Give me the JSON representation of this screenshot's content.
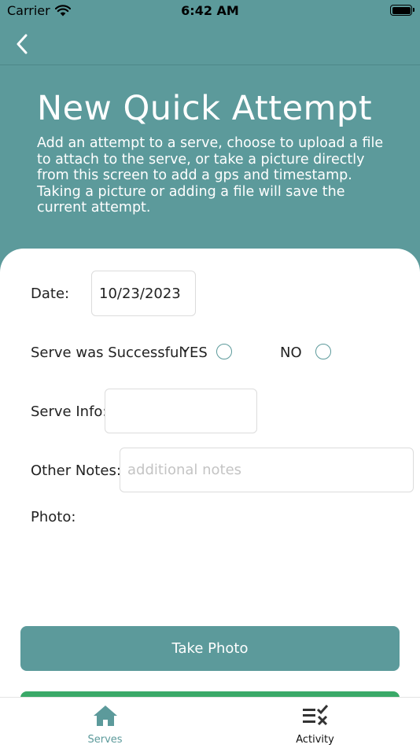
{
  "status_bar": {
    "carrier": "Carrier",
    "time": "6:42 AM"
  },
  "header": {
    "title": "New Quick Attempt",
    "description": "Add an attempt to a serve, choose to upload a file to attach to the serve, or take a picture directly from this screen to add a gps and timestamp. Taking a picture or adding a file will save the current attempt."
  },
  "form": {
    "date_label": "Date:",
    "date_value": "10/23/2023",
    "success_label": "Serve was Successful:",
    "yes_label": "YES",
    "no_label": "NO",
    "serve_info_label": "Serve Info:",
    "serve_info_value": "",
    "other_notes_label": "Other Notes:",
    "other_notes_placeholder": "additional notes",
    "photo_label": "Photo:"
  },
  "buttons": {
    "take_photo": "Take Photo"
  },
  "tab_bar": {
    "items": [
      {
        "label": "Serves",
        "icon": "home-icon",
        "active": true
      },
      {
        "label": "Activity",
        "icon": "checklist-icon",
        "active": false
      }
    ]
  },
  "colors": {
    "primary": "#5c9a9b",
    "success": "#3aa968",
    "active_tab_text": "#5c9a9b",
    "inactive_tab_text": "#111111"
  }
}
